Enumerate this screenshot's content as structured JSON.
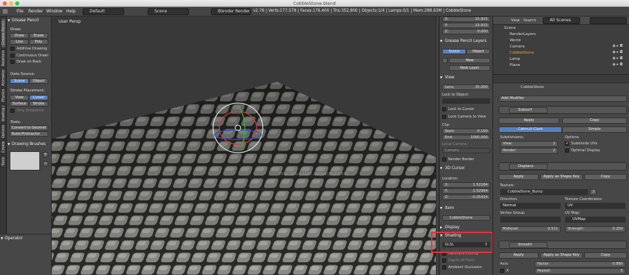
{
  "window": {
    "title": "CobbleStone.blend"
  },
  "menubar": {
    "items": [
      "File",
      "Render",
      "Window",
      "Help"
    ],
    "layout": "Default",
    "scene": "Scene",
    "engine": "Blender Render",
    "stats": "v2.76 | Verts:177,578 | Faces:176,400 | Tris:352,800 | Objects:1/4 | Lamps:0/1 | Mem:288.63M | CobbleStone"
  },
  "tool_tabs": [
    "Grease Pencil",
    "Relations",
    "Animation",
    "Physics",
    "Shading / UVs",
    "Options",
    "Create",
    "Tools"
  ],
  "shelf": {
    "header": "Grease Pencil",
    "draw_label": "Draw:",
    "draw_btn": "Draw",
    "erase_btn": "Erase",
    "line_btn": "Line",
    "poly_btn": "Poly",
    "additive": "Additive Drawing",
    "continuous": "Continuous Drawi",
    "draw_on_back": "Draw on Back",
    "data_source": "Data Source:",
    "scene_btn": "Scene",
    "object_btn": "Object",
    "stroke_placement": "Stroke Placement:",
    "view_btn": "View",
    "cursor_btn": "Cursor",
    "surface_btn": "Surface",
    "stroke_btn": "Stroke",
    "only_endpoints": "Only Endpoints",
    "tools": "Tools:",
    "convert": "Convert to Geomet",
    "ruler": "Ruler/Protractor",
    "drawing_brushes": "Drawing Brushes"
  },
  "operator": {
    "header": "Operator"
  },
  "viewport": {
    "label": "User Persp",
    "watermark": "http://blog.csdn.net/pastfish1983"
  },
  "npanel": {
    "x": "X:",
    "x_val": "15.915",
    "y": "Y:",
    "y_val": "15.915",
    "z": "Z:",
    "z_val": "0.000",
    "gp_layers": "Grease Pencil Layers",
    "scene_btn": "Scene",
    "object_btn": "Object",
    "new_btn": "New",
    "new_layer_btn": "New Layer",
    "view_hdr": "View",
    "lens": "Lens:",
    "lens_val": "35.000",
    "lock_obj": "Lock to Object:",
    "lock_cursor": "Lock to Cursor",
    "lock_camera": "Lock Camera to View",
    "clip": "Clip:",
    "clip_start": "Start:",
    "clip_start_val": "0.100",
    "clip_end": "End:",
    "clip_end_val": "1000.000",
    "local_camera": "Local Camera:",
    "camera_field": "Camera",
    "render_border": "Render Border",
    "cursor3d": "3D Cursor",
    "location": "Location:",
    "cx": "X:",
    "cx_val": "1.52184",
    "cy": "Y:",
    "cy_val": "2.52994",
    "cz": "Z:",
    "cz_val": "-0.05434",
    "item_hdr": "Item",
    "item_name": "CobbleStone",
    "display_hdr": "Display",
    "shading_hdr": "Shading",
    "shading_val": "GLSL",
    "backface": "Backface Culling",
    "dof": "Depth Of Field",
    "ao": "Ambient Occlusion"
  },
  "outliner": {
    "view": "View",
    "search": "Search",
    "all_scenes": "All Scenes",
    "rows": [
      "Scene",
      "RenderLayers",
      "World",
      "Camera",
      "CobbleStone",
      "Lamp",
      "Plane"
    ]
  },
  "properties": {
    "object": "CobbleStone",
    "add_modifier": "Add Modifier",
    "subsurf": {
      "name": "Subsurf",
      "apply": "Apply",
      "copy": "Copy",
      "catmull": "Catmull-Clark",
      "simple": "Simple",
      "subdivisions": "Subdivisions:",
      "view": "View:",
      "view_val": "2",
      "render": "Render:",
      "render_val": "2",
      "options": "Options",
      "subdivide_uvs": "Subdivide UVs",
      "optimal": "Optimal Display"
    },
    "displace": {
      "name": "Displace",
      "apply": "Apply",
      "apply_shape": "Apply as Shape Key",
      "copy": "Copy",
      "texture": "Texture:",
      "texture_name": "CobbleStone_Bump",
      "tex_users": "2",
      "direction": "Direction:",
      "direction_val": "Normal",
      "tex_coords": "Texture Coordinates:",
      "tex_coords_val": "UV",
      "vertex_group": "Vertex Group:",
      "uv_map": "UV Map:",
      "uv_map_val": "UVMap",
      "midlevel": "Midlevel:",
      "midlevel_val": "0.511",
      "strength": "Strength:",
      "strength_val": "0.250"
    },
    "smooth": {
      "name": "Smooth",
      "apply": "Apply",
      "apply_shape": "Apply as Shape Key",
      "copy": "Copy",
      "axis": "Axis:",
      "x": "X",
      "factor": "Factor:",
      "factor_val": "0.880",
      "repeat": "Repeat:",
      "repeat_val": "5"
    }
  },
  "colors": {
    "accent": "#5680c2",
    "highlight": "#e8333a",
    "selected": "#f5a623"
  }
}
